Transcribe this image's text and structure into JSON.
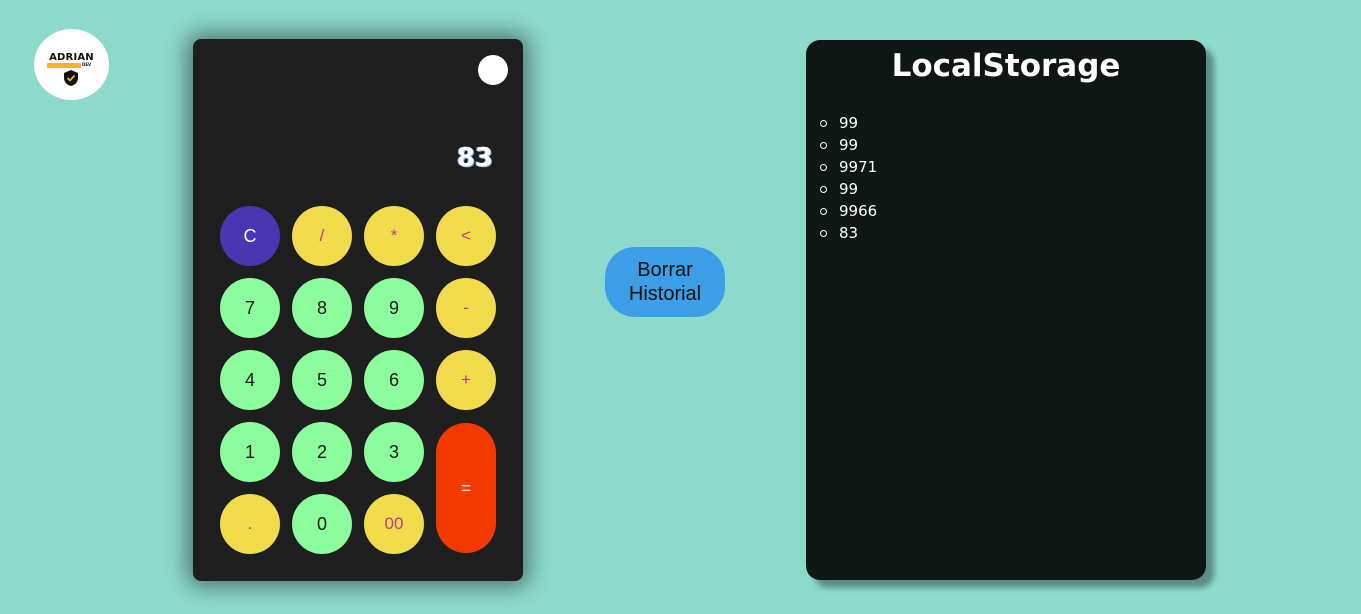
{
  "logo": {
    "name": "ADRIAN",
    "sub": "DEV"
  },
  "calculator": {
    "display": "83",
    "keys": {
      "clear": "C",
      "divide": "/",
      "multiply": "*",
      "backspace": "<",
      "seven": "7",
      "eight": "8",
      "nine": "9",
      "minus": "-",
      "four": "4",
      "five": "5",
      "six": "6",
      "plus": "+",
      "one": "1",
      "two": "2",
      "three": "3",
      "equals": "=",
      "dot": ".",
      "zero": "0",
      "double_zero": "00"
    }
  },
  "clear_history_label": "Borrar\nHistorial",
  "storage": {
    "title": "LocalStorage",
    "items": [
      "99",
      "99",
      "9971",
      "99",
      "9966",
      "83"
    ]
  },
  "colors": {
    "background": "#8dd9cc",
    "number_key": "#8cfd9c",
    "operator_key": "#f1dc4c",
    "clear_key": "#4a35b3",
    "equals_key": "#f53a00",
    "history_button": "#3c9ee7"
  }
}
